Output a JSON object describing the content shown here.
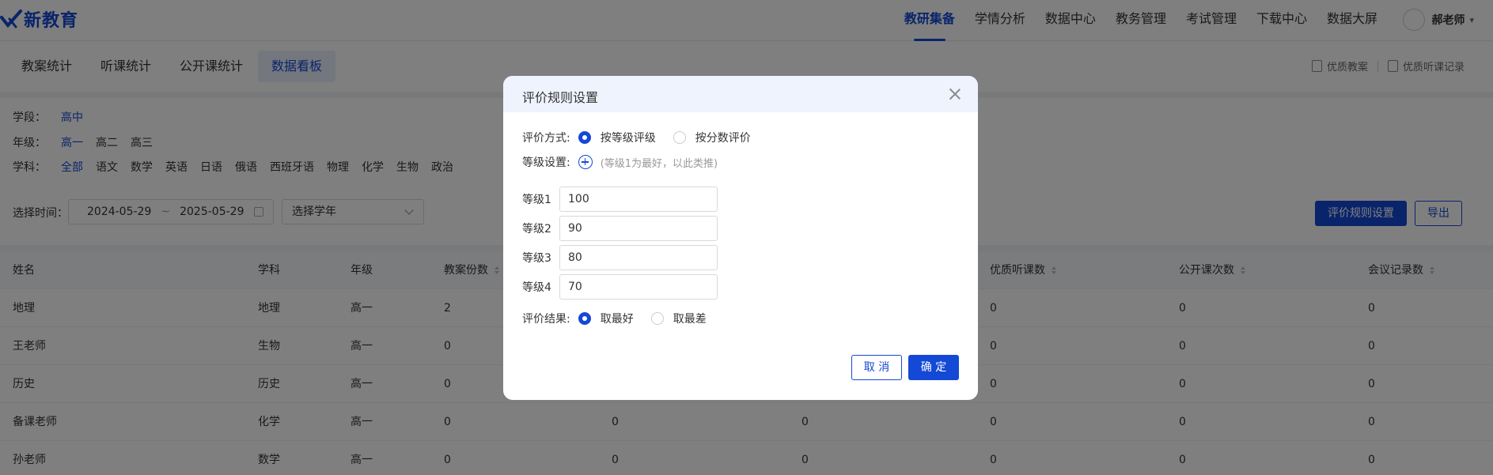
{
  "header": {
    "logo_text": "新教育",
    "nav": [
      "教研集备",
      "学情分析",
      "数据中心",
      "教务管理",
      "考试管理",
      "下载中心",
      "数据大屏"
    ],
    "active_nav": "教研集备",
    "user_name": "郝老师",
    "caret": "▾"
  },
  "tabs": [
    "教案统计",
    "听课统计",
    "公开课统计",
    "数据看板"
  ],
  "active_tab": "数据看板",
  "quick_links": [
    "优质教案",
    "优质听课记录"
  ],
  "filters": {
    "stage_label": "学段：",
    "stage_options": [
      "高中"
    ],
    "grade_label": "年级：",
    "grade_options": [
      "高一",
      "高二",
      "高三"
    ],
    "subject_label": "学科：",
    "subject_options": [
      "全部",
      "语文",
      "数学",
      "英语",
      "日语",
      "俄语",
      "西班牙语",
      "物理",
      "化学",
      "生物",
      "政治"
    ],
    "time_label": "选择时间：",
    "date_start": "2024-05-29",
    "date_sep": "~",
    "date_end": "2025-05-29",
    "year_select": "选择学年",
    "rule_button": "评价规则设置",
    "export_button": "导出"
  },
  "table": {
    "columns": [
      "姓名",
      "学科",
      "年级",
      "教案份数",
      "",
      "",
      "优质听课数",
      "公开课次数",
      "会议记录数"
    ],
    "rows": [
      [
        "地理",
        "地理",
        "高一",
        "2",
        "",
        "",
        "0",
        "0",
        "0"
      ],
      [
        "王老师",
        "生物",
        "高一",
        "0",
        "",
        "",
        "0",
        "0",
        "0"
      ],
      [
        "历史",
        "历史",
        "高一",
        "0",
        "",
        "",
        "0",
        "0",
        "0"
      ],
      [
        "备课老师",
        "化学",
        "高一",
        "0",
        "0",
        "0",
        "0",
        "0",
        "0"
      ],
      [
        "孙老师",
        "数学",
        "高一",
        "0",
        "0",
        "0",
        "0",
        "0",
        "0"
      ]
    ]
  },
  "modal": {
    "title": "评价规则设置",
    "method_label": "评价方式:",
    "method_options": [
      "按等级评级",
      "按分数评价"
    ],
    "method_selected": "按等级评级",
    "level_setting_label": "等级设置:",
    "level_hint": "(等级1为最好，以此类推)",
    "levels": [
      {
        "label": "等级1",
        "value": "100"
      },
      {
        "label": "等级2",
        "value": "90"
      },
      {
        "label": "等级3",
        "value": "80"
      },
      {
        "label": "等级4",
        "value": "70"
      }
    ],
    "result_label": "评价结果:",
    "result_options": [
      "取最好",
      "取最差"
    ],
    "result_selected": "取最好",
    "cancel_label": "取 消",
    "ok_label": "确 定"
  },
  "colors": {
    "accent": "#1449d6",
    "overlay": "rgba(0,0,0,0.5)",
    "modal_header_bg": "#eef3fd"
  }
}
